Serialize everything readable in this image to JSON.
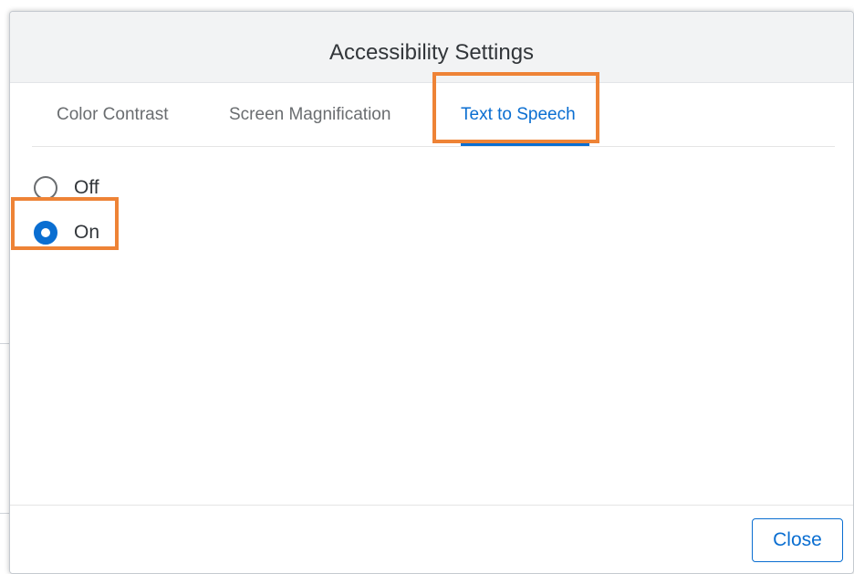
{
  "dialog": {
    "title": "Accessibility Settings"
  },
  "tabs": [
    {
      "label": "Color Contrast",
      "selected": false
    },
    {
      "label": "Screen Magnification",
      "selected": false
    },
    {
      "label": "Text to Speech",
      "selected": true
    }
  ],
  "options": [
    {
      "label": "Off",
      "selected": false
    },
    {
      "label": "On",
      "selected": true
    }
  ],
  "footer": {
    "close_label": "Close"
  },
  "colors": {
    "accent": "#0a6ed1",
    "highlight": "#ee8336",
    "header_bg": "#f2f3f4"
  }
}
